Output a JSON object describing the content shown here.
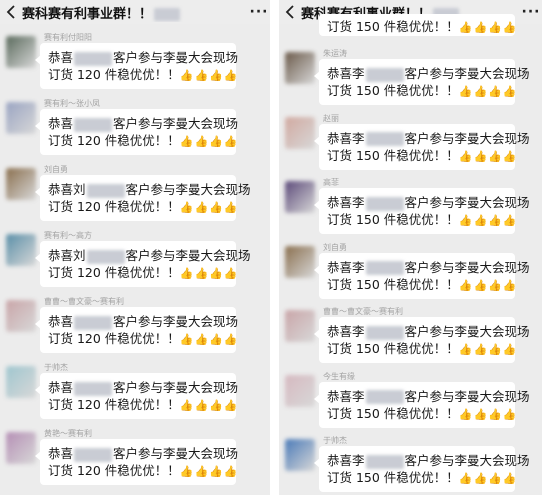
{
  "left": {
    "title": "赛科赛有利事业群！！",
    "messages": [
      {
        "name": "赛有利付阳阳",
        "line1_pre": "恭喜",
        "line1_post": "客户参与李曼大会现场",
        "line2": "订货 120 件稳优优！！",
        "thumbs": "👍👍👍👍",
        "color": "#5a6a5c"
      },
      {
        "name": "赛有利～张小凤",
        "line1_pre": "恭喜",
        "line1_post": "客户参与李曼大会现场",
        "line2": "订货 120 件稳优优！！",
        "thumbs": "👍👍👍👍",
        "color": "#9aa4c2"
      },
      {
        "name": "刘自勇",
        "line1_pre": "恭喜刘",
        "line1_post": "客户参与李曼大会现场",
        "line2": "订货 120 件稳优优！！",
        "thumbs": "👍👍👍👍",
        "color": "#8a6f4e"
      },
      {
        "name": "赛有利～高方",
        "line1_pre": "恭喜刘",
        "line1_post": "客户参与李曼大会现场",
        "line2": "订货 120 件稳优优！！",
        "thumbs": "👍👍👍👍",
        "color": "#5a8fa8"
      },
      {
        "name": "曹曹～曹文豪～赛有利",
        "line1_pre": "恭喜",
        "line1_post": "客户参与李曼大会现场",
        "line2": "订货 120 件稳优优！！",
        "thumbs": "👍👍👍👍",
        "color": "#c9a5a8"
      },
      {
        "name": "于帅杰",
        "line1_pre": "恭喜",
        "line1_post": "客户参与李曼大会现场",
        "line2": "订货 120 件稳优优！！",
        "thumbs": "👍👍👍👍",
        "color": "#9fc6cf"
      },
      {
        "name": "黄艳～赛有利",
        "line1_pre": "恭喜",
        "line1_post": "客户参与李曼大会现场",
        "line2": "订货 120 件稳优优！！",
        "thumbs": "👍👍👍👍",
        "color": "#b58fb5"
      }
    ]
  },
  "right": {
    "title": "赛科赛有利事业群！！",
    "top_line": "订货 150 件稳优优！！",
    "top_thumbs": "👍👍👍👍",
    "messages": [
      {
        "name": "朱运涛",
        "line1_pre": "恭喜李",
        "line1_post": "客户参与李曼大会现场",
        "line2": "订货 150 件稳优优！！",
        "thumbs": "👍👍👍👍",
        "color": "#6b5a4a"
      },
      {
        "name": "赵丽",
        "line1_pre": "恭喜李",
        "line1_post": "客户参与李曼大会现场",
        "line2": "订货 150 件稳优优！！",
        "thumbs": "👍👍👍👍",
        "color": "#d1a9a0"
      },
      {
        "name": "高菲",
        "line1_pre": "恭喜李",
        "line1_post": "客户参与李曼大会现场",
        "line2": "订货 150 件稳优优！！",
        "thumbs": "👍👍👍👍",
        "color": "#5c4a7a"
      },
      {
        "name": "刘自勇",
        "line1_pre": "恭喜李",
        "line1_post": "客户参与李曼大会现场",
        "line2": "订货 150 件稳优优！！",
        "thumbs": "👍👍👍👍",
        "color": "#8a6f4e"
      },
      {
        "name": "曹曹～曹文豪～赛有利",
        "line1_pre": "恭喜李",
        "line1_post": "客户参与李曼大会现场",
        "line2": "订货 150 件稳优优！！",
        "thumbs": "👍👍👍👍",
        "color": "#c9a5a8"
      },
      {
        "name": "今生有缘",
        "line1_pre": "恭喜李",
        "line1_post": "客户参与李曼大会现场",
        "line2": "订货 150 件稳优优！！",
        "thumbs": "👍👍👍👍",
        "color": "#d6b9c0"
      },
      {
        "name": "于帅杰",
        "line1_pre": "恭喜李",
        "line1_post": "客户参与李曼大会现场",
        "line2": "订货 150 件稳优优！！",
        "thumbs": "👍👍👍👍",
        "color": "#4a7ab8"
      }
    ]
  }
}
